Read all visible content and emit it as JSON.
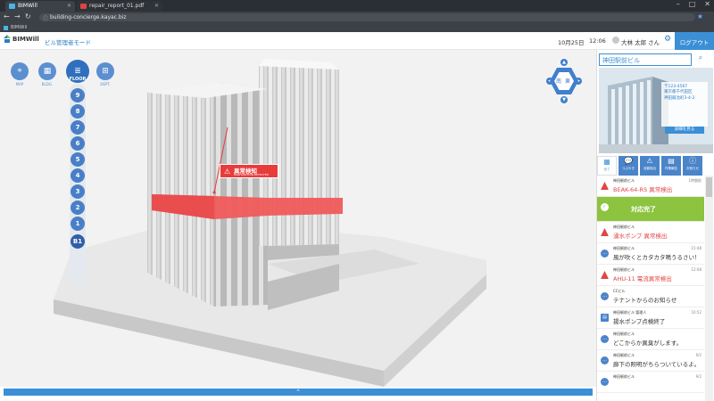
{
  "browser": {
    "tabs": [
      {
        "label": "BIMWill"
      },
      {
        "label": "repair_report_01.pdf"
      }
    ],
    "url": "building-concierge.kayac.biz",
    "bookmark": "BIMWill"
  },
  "header": {
    "logo": "BIMWill",
    "mode": "ビル管理者モード",
    "date": "10月25日",
    "time": "12:06",
    "user": "大林 太郎 さん",
    "logout": "ログアウト"
  },
  "modes": [
    {
      "label": "MAP"
    },
    {
      "label": "BLDG."
    },
    {
      "label": "FLOOR"
    },
    {
      "label": "DEPT."
    }
  ],
  "floors": [
    "9",
    "8",
    "7",
    "6",
    "5",
    "4",
    "3",
    "2",
    "1",
    "B1"
  ],
  "compass": {
    "south": "南",
    "east": "東"
  },
  "alert": {
    "title": "異常検知",
    "subtitle": "MALFUNCTION DETECTED"
  },
  "side": {
    "building_name": "神田駅前ビル",
    "address": [
      "〒123-4567",
      "東京都千代田区",
      "神田鍛冶町3-4-2"
    ],
    "detail_btn": "詳細を見る",
    "categories": [
      {
        "label": "全て"
      },
      {
        "label": "つぶやき"
      },
      {
        "label": "自動検出"
      },
      {
        "label": "作業報告"
      },
      {
        "label": "お知らせ"
      }
    ],
    "feed": [
      {
        "src": "神田駅前ビル",
        "msg": "BEAK-64-RS 異常検出",
        "time": "1時間前",
        "type": "alarm"
      },
      {
        "src": "",
        "msg": "対応完了",
        "time": "",
        "type": "done"
      },
      {
        "src": "神田駅前ビル",
        "msg": "湧水ポンプ 異常検出",
        "time": "",
        "type": "alarm"
      },
      {
        "src": "神田駅前ビル",
        "msg": "風が吹くとカタカタ鳴うるさい！",
        "time": "15:48",
        "type": "chat"
      },
      {
        "src": "神田駅前ビル",
        "msg": "AHU-11 電流異常検出",
        "time": "12:08",
        "type": "alarm"
      },
      {
        "src": "CCビル",
        "msg": "テナントからのお知らせ",
        "time": "",
        "type": "chat"
      },
      {
        "src": "神田駅前ビル 管理人",
        "msg": "揚水ポンプ点検終了",
        "time": "10:52",
        "type": "doc"
      },
      {
        "src": "神田駅前ビル",
        "msg": "どこからか異臭がします。",
        "time": "",
        "type": "chat"
      },
      {
        "src": "神田駅前ビル",
        "msg": "廊下の照明がちらついているよ。",
        "time": "9/2",
        "type": "chat"
      },
      {
        "src": "神田駅前ビル",
        "msg": "",
        "time": "9/2",
        "type": "chat"
      }
    ]
  },
  "colors": {
    "accent": "#3b8fd6",
    "alarm": "#e24545",
    "done": "#8cc33f",
    "band": "#f05a5a"
  }
}
